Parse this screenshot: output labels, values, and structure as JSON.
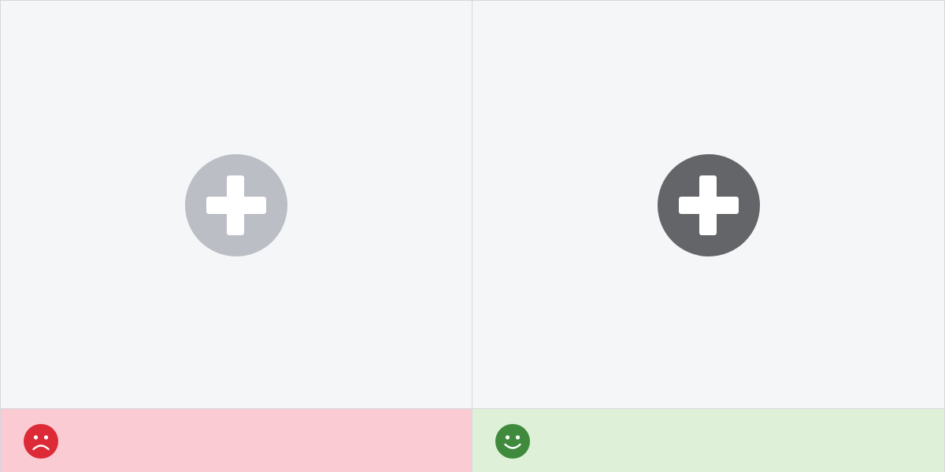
{
  "colors": {
    "canvas_background": "#f4f6f8",
    "divider": "#d5d7db",
    "plus_glyph": "#ffffff"
  },
  "examples": [
    {
      "verdict": "dont",
      "add_icon": {
        "name": "plus-circle-icon",
        "fill_color": "#bbbec4"
      },
      "verdict_bar": {
        "background_color": "#fbcbd4",
        "icon": "sad-face-icon",
        "icon_color": "#dc2a36"
      }
    },
    {
      "verdict": "do",
      "add_icon": {
        "name": "plus-circle-icon",
        "fill_color": "#646568"
      },
      "verdict_bar": {
        "background_color": "#dff0d8",
        "icon": "happy-face-icon",
        "icon_color": "#3f8a3c"
      }
    }
  ]
}
